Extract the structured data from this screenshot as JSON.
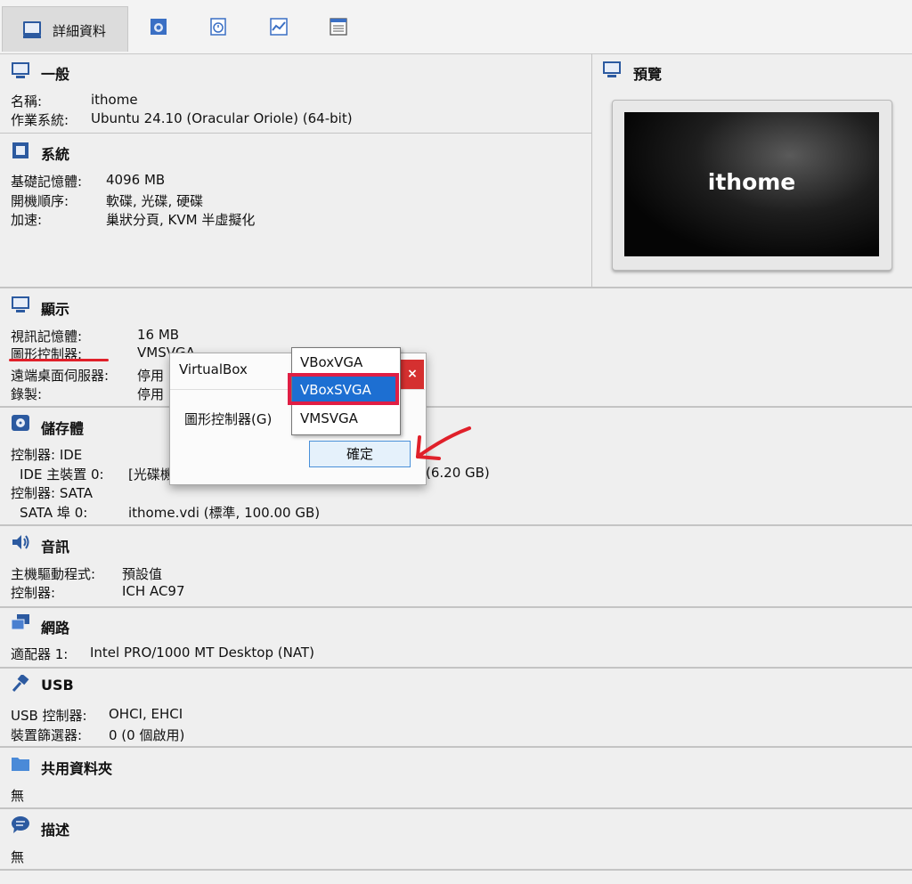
{
  "toolbar": {
    "details_tab": "詳細資料",
    "icons": [
      "details-icon",
      "snapshots-icon",
      "logs-icon",
      "performance-icon",
      "list-icon"
    ]
  },
  "general": {
    "title": "一般",
    "rows": [
      {
        "label": "名稱:",
        "value": "ithome"
      },
      {
        "label": "作業系統:",
        "value": "Ubuntu 24.10 (Oracular Oriole) (64-bit)"
      }
    ]
  },
  "system": {
    "title": "系統",
    "rows": [
      {
        "label": "基礎記憶體:",
        "value": "4096 MB"
      },
      {
        "label": "開機順序:",
        "value": "軟碟, 光碟, 硬碟"
      },
      {
        "label": "加速:",
        "value": "巢狀分頁, KVM 半虛擬化"
      }
    ]
  },
  "preview": {
    "title": "預覽",
    "screen_text": "ithome"
  },
  "display": {
    "title": "顯示",
    "rows": [
      {
        "label": "視訊記憶體:",
        "value": "16 MB"
      },
      {
        "label": "圖形控制器:",
        "value": "VMSVGA"
      },
      {
        "label": "遠端桌面伺服器:",
        "value": "停用"
      },
      {
        "label": "錄製:",
        "value": "停用"
      }
    ]
  },
  "storage": {
    "title": "儲存體",
    "controller_ide": "控制器: IDE",
    "ide_label": "IDE 主裝置 0:",
    "ide_value": "[光碟機",
    "ide_tail": "(6.20 GB)",
    "controller_sata": "控制器: SATA",
    "sata_label": "SATA 埠 0:",
    "sata_value": "ithome.vdi (標準, 100.00 GB)"
  },
  "audio": {
    "title": "音訊",
    "rows": [
      {
        "label": "主機驅動程式:",
        "value": "預設值"
      },
      {
        "label": "控制器:",
        "value": "ICH AC97"
      }
    ]
  },
  "network": {
    "title": "網路",
    "rows": [
      {
        "label": "適配器 1:",
        "value": "Intel PRO/1000 MT Desktop (NAT)"
      }
    ]
  },
  "usb": {
    "title": "USB",
    "rows": [
      {
        "label": "USB 控制器:",
        "value": "OHCI, EHCI"
      },
      {
        "label": "裝置篩選器:",
        "value": "0 (0 個啟用)"
      }
    ]
  },
  "shared": {
    "title": "共用資料夾",
    "value": "無"
  },
  "description": {
    "title": "描述",
    "value": "無"
  },
  "dialog": {
    "title": "VirtualBox",
    "close": "×",
    "field_label": "圖形控制器(G)",
    "ok": "確定",
    "options": [
      "VBoxVGA",
      "VBoxSVGA",
      "VMSVGA"
    ],
    "selected": "VBoxSVGA"
  },
  "colors": {
    "accent_selection": "#1d6fd2",
    "highlight_box": "#e01e44",
    "close_button": "#d53030"
  }
}
